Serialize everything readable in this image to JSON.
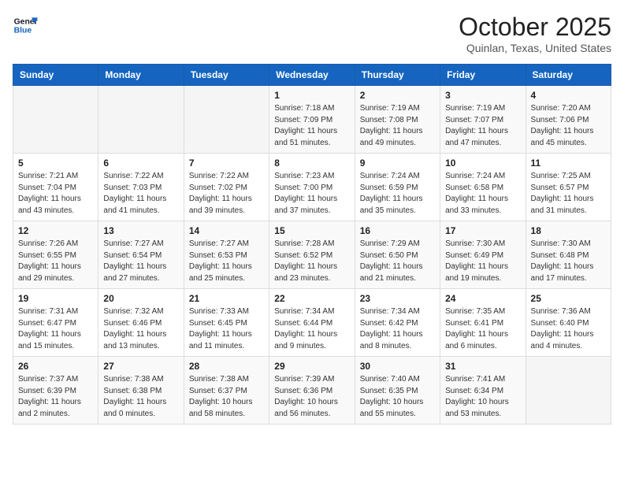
{
  "header": {
    "logo_general": "General",
    "logo_blue": "Blue",
    "month": "October 2025",
    "location": "Quinlan, Texas, United States"
  },
  "weekdays": [
    "Sunday",
    "Monday",
    "Tuesday",
    "Wednesday",
    "Thursday",
    "Friday",
    "Saturday"
  ],
  "weeks": [
    [
      {
        "day": "",
        "sunrise": "",
        "sunset": "",
        "daylight": ""
      },
      {
        "day": "",
        "sunrise": "",
        "sunset": "",
        "daylight": ""
      },
      {
        "day": "",
        "sunrise": "",
        "sunset": "",
        "daylight": ""
      },
      {
        "day": "1",
        "sunrise": "Sunrise: 7:18 AM",
        "sunset": "Sunset: 7:09 PM",
        "daylight": "Daylight: 11 hours and 51 minutes."
      },
      {
        "day": "2",
        "sunrise": "Sunrise: 7:19 AM",
        "sunset": "Sunset: 7:08 PM",
        "daylight": "Daylight: 11 hours and 49 minutes."
      },
      {
        "day": "3",
        "sunrise": "Sunrise: 7:19 AM",
        "sunset": "Sunset: 7:07 PM",
        "daylight": "Daylight: 11 hours and 47 minutes."
      },
      {
        "day": "4",
        "sunrise": "Sunrise: 7:20 AM",
        "sunset": "Sunset: 7:06 PM",
        "daylight": "Daylight: 11 hours and 45 minutes."
      }
    ],
    [
      {
        "day": "5",
        "sunrise": "Sunrise: 7:21 AM",
        "sunset": "Sunset: 7:04 PM",
        "daylight": "Daylight: 11 hours and 43 minutes."
      },
      {
        "day": "6",
        "sunrise": "Sunrise: 7:22 AM",
        "sunset": "Sunset: 7:03 PM",
        "daylight": "Daylight: 11 hours and 41 minutes."
      },
      {
        "day": "7",
        "sunrise": "Sunrise: 7:22 AM",
        "sunset": "Sunset: 7:02 PM",
        "daylight": "Daylight: 11 hours and 39 minutes."
      },
      {
        "day": "8",
        "sunrise": "Sunrise: 7:23 AM",
        "sunset": "Sunset: 7:00 PM",
        "daylight": "Daylight: 11 hours and 37 minutes."
      },
      {
        "day": "9",
        "sunrise": "Sunrise: 7:24 AM",
        "sunset": "Sunset: 6:59 PM",
        "daylight": "Daylight: 11 hours and 35 minutes."
      },
      {
        "day": "10",
        "sunrise": "Sunrise: 7:24 AM",
        "sunset": "Sunset: 6:58 PM",
        "daylight": "Daylight: 11 hours and 33 minutes."
      },
      {
        "day": "11",
        "sunrise": "Sunrise: 7:25 AM",
        "sunset": "Sunset: 6:57 PM",
        "daylight": "Daylight: 11 hours and 31 minutes."
      }
    ],
    [
      {
        "day": "12",
        "sunrise": "Sunrise: 7:26 AM",
        "sunset": "Sunset: 6:55 PM",
        "daylight": "Daylight: 11 hours and 29 minutes."
      },
      {
        "day": "13",
        "sunrise": "Sunrise: 7:27 AM",
        "sunset": "Sunset: 6:54 PM",
        "daylight": "Daylight: 11 hours and 27 minutes."
      },
      {
        "day": "14",
        "sunrise": "Sunrise: 7:27 AM",
        "sunset": "Sunset: 6:53 PM",
        "daylight": "Daylight: 11 hours and 25 minutes."
      },
      {
        "day": "15",
        "sunrise": "Sunrise: 7:28 AM",
        "sunset": "Sunset: 6:52 PM",
        "daylight": "Daylight: 11 hours and 23 minutes."
      },
      {
        "day": "16",
        "sunrise": "Sunrise: 7:29 AM",
        "sunset": "Sunset: 6:50 PM",
        "daylight": "Daylight: 11 hours and 21 minutes."
      },
      {
        "day": "17",
        "sunrise": "Sunrise: 7:30 AM",
        "sunset": "Sunset: 6:49 PM",
        "daylight": "Daylight: 11 hours and 19 minutes."
      },
      {
        "day": "18",
        "sunrise": "Sunrise: 7:30 AM",
        "sunset": "Sunset: 6:48 PM",
        "daylight": "Daylight: 11 hours and 17 minutes."
      }
    ],
    [
      {
        "day": "19",
        "sunrise": "Sunrise: 7:31 AM",
        "sunset": "Sunset: 6:47 PM",
        "daylight": "Daylight: 11 hours and 15 minutes."
      },
      {
        "day": "20",
        "sunrise": "Sunrise: 7:32 AM",
        "sunset": "Sunset: 6:46 PM",
        "daylight": "Daylight: 11 hours and 13 minutes."
      },
      {
        "day": "21",
        "sunrise": "Sunrise: 7:33 AM",
        "sunset": "Sunset: 6:45 PM",
        "daylight": "Daylight: 11 hours and 11 minutes."
      },
      {
        "day": "22",
        "sunrise": "Sunrise: 7:34 AM",
        "sunset": "Sunset: 6:44 PM",
        "daylight": "Daylight: 11 hours and 9 minutes."
      },
      {
        "day": "23",
        "sunrise": "Sunrise: 7:34 AM",
        "sunset": "Sunset: 6:42 PM",
        "daylight": "Daylight: 11 hours and 8 minutes."
      },
      {
        "day": "24",
        "sunrise": "Sunrise: 7:35 AM",
        "sunset": "Sunset: 6:41 PM",
        "daylight": "Daylight: 11 hours and 6 minutes."
      },
      {
        "day": "25",
        "sunrise": "Sunrise: 7:36 AM",
        "sunset": "Sunset: 6:40 PM",
        "daylight": "Daylight: 11 hours and 4 minutes."
      }
    ],
    [
      {
        "day": "26",
        "sunrise": "Sunrise: 7:37 AM",
        "sunset": "Sunset: 6:39 PM",
        "daylight": "Daylight: 11 hours and 2 minutes."
      },
      {
        "day": "27",
        "sunrise": "Sunrise: 7:38 AM",
        "sunset": "Sunset: 6:38 PM",
        "daylight": "Daylight: 11 hours and 0 minutes."
      },
      {
        "day": "28",
        "sunrise": "Sunrise: 7:38 AM",
        "sunset": "Sunset: 6:37 PM",
        "daylight": "Daylight: 10 hours and 58 minutes."
      },
      {
        "day": "29",
        "sunrise": "Sunrise: 7:39 AM",
        "sunset": "Sunset: 6:36 PM",
        "daylight": "Daylight: 10 hours and 56 minutes."
      },
      {
        "day": "30",
        "sunrise": "Sunrise: 7:40 AM",
        "sunset": "Sunset: 6:35 PM",
        "daylight": "Daylight: 10 hours and 55 minutes."
      },
      {
        "day": "31",
        "sunrise": "Sunrise: 7:41 AM",
        "sunset": "Sunset: 6:34 PM",
        "daylight": "Daylight: 10 hours and 53 minutes."
      },
      {
        "day": "",
        "sunrise": "",
        "sunset": "",
        "daylight": ""
      }
    ]
  ]
}
